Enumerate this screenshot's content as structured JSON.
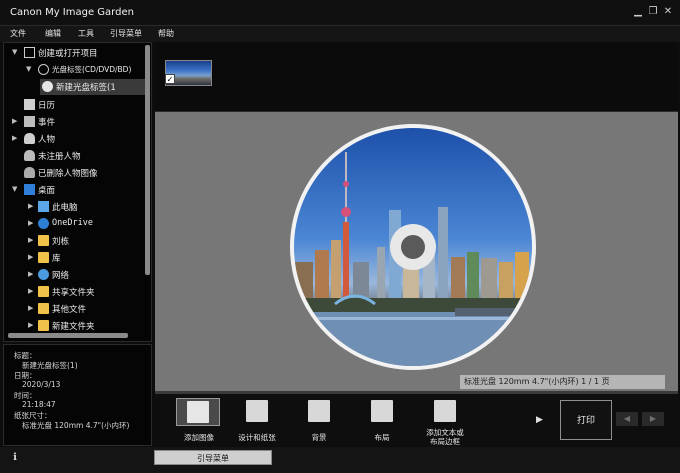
{
  "window": {
    "title": "Canon My Image Garden"
  },
  "menu": [
    "文件",
    "编辑",
    "工具",
    "引导菜单",
    "帮助"
  ],
  "tree": [
    {
      "label": "创建或打开项目",
      "arrow": "▼"
    },
    {
      "label": "光盘标签(CD/DVD/BD)",
      "arrow": "▼"
    },
    {
      "label": "新建光盘标签(1",
      "arrow": ""
    },
    {
      "label": "日历",
      "arrow": ""
    },
    {
      "label": "事件",
      "arrow": "▶"
    },
    {
      "label": "人物",
      "arrow": "▶"
    },
    {
      "label": "未注册人物",
      "arrow": ""
    },
    {
      "label": "已删除人物图像",
      "arrow": ""
    },
    {
      "label": "桌面",
      "arrow": "▼"
    },
    {
      "label": "此电脑",
      "arrow": "▶"
    },
    {
      "label": "OneDrive",
      "arrow": "▶"
    },
    {
      "label": "刘栋",
      "arrow": "▶"
    },
    {
      "label": "库",
      "arrow": "▶"
    },
    {
      "label": "网络",
      "arrow": "▶"
    },
    {
      "label": "共享文件夹",
      "arrow": "▶"
    },
    {
      "label": "其他文件",
      "arrow": "▶"
    },
    {
      "label": "新建文件夹",
      "arrow": "▶"
    }
  ],
  "info": {
    "title_label": "标题：",
    "title_value": "新建光盘标签(1)",
    "date_label": "日期：",
    "date_value": "2020/3/13",
    "time_label": "时间：",
    "time_value": "21:18:47",
    "paper_label": "纸张尺寸：",
    "paper_value": "标准光盘 120mm 4.7\"(小内环)"
  },
  "page_status": "标准光盘 120mm 4.7\"(小内环) 1 / 1 页",
  "tools": [
    {
      "label": "添加图像"
    },
    {
      "label": "设计和纸张"
    },
    {
      "label": "背景"
    },
    {
      "label": "布局"
    },
    {
      "label": "添加文本或\n布局边框"
    }
  ],
  "print_label": "打印",
  "guide_menu_label": "引导菜单",
  "colors": {
    "background": "#0d0d0d",
    "workarea": "#777777",
    "folder": "#f0c24a",
    "disc_face": "#f2f2f2"
  }
}
